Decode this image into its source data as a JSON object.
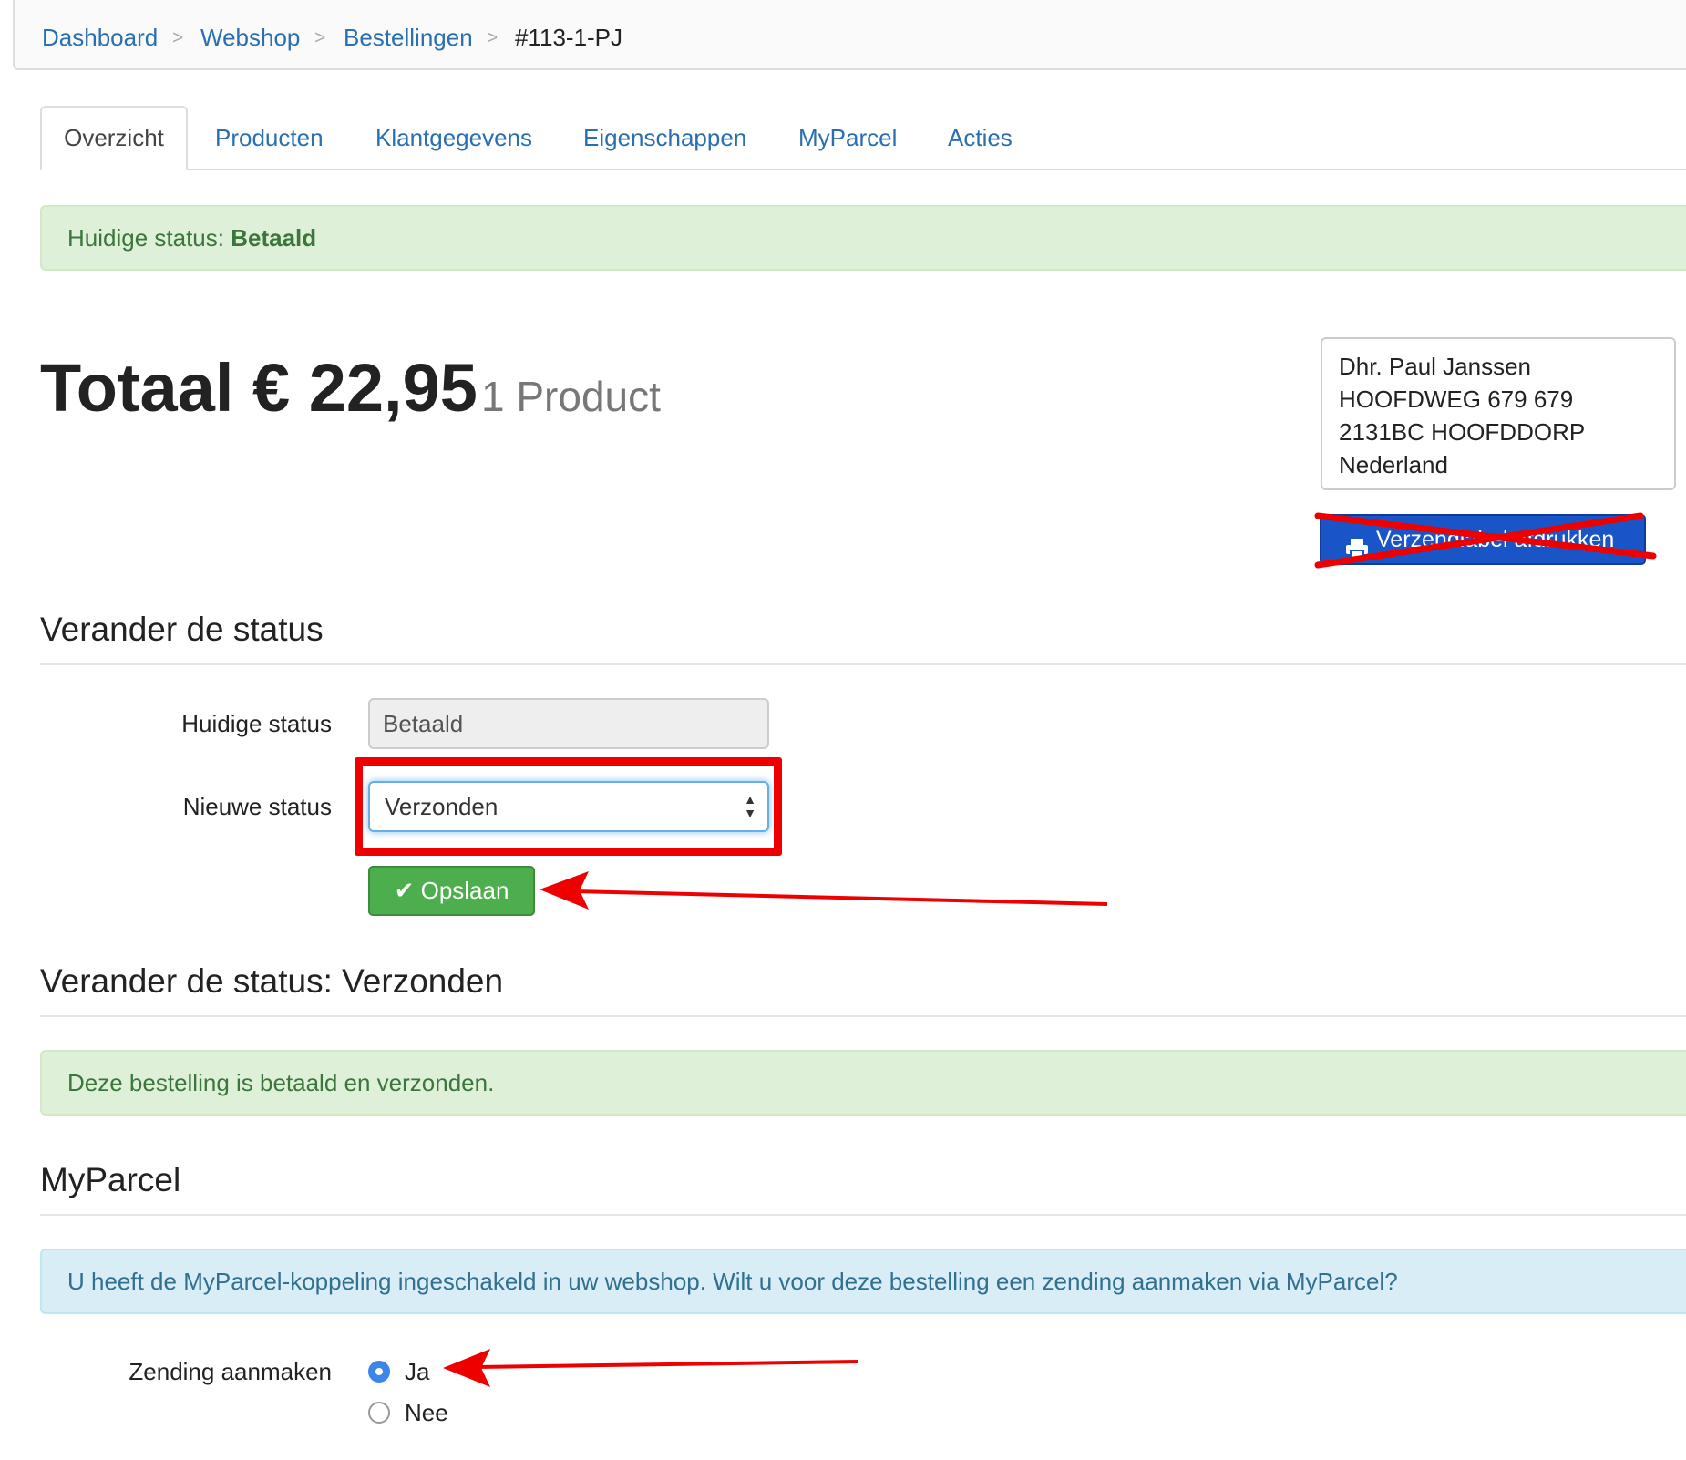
{
  "breadcrumb": {
    "items": [
      {
        "label": "Dashboard"
      },
      {
        "label": "Webshop"
      },
      {
        "label": "Bestellingen"
      }
    ],
    "current": "#113-1-PJ",
    "separator": ">"
  },
  "tabs": [
    {
      "label": "Overzicht",
      "active": true
    },
    {
      "label": "Producten"
    },
    {
      "label": "Klantgegevens"
    },
    {
      "label": "Eigenschappen"
    },
    {
      "label": "MyParcel"
    },
    {
      "label": "Acties"
    }
  ],
  "status_alert": {
    "prefix": "Huidige status:",
    "value": "Betaald"
  },
  "total": {
    "label": "Totaal € 22,95",
    "count": "1 Product"
  },
  "address": {
    "lines": [
      "Dhr. Paul Janssen",
      "HOOFDWEG 679 679",
      "2131BC HOOFDDORP",
      "Nederland"
    ]
  },
  "print_button": {
    "label": "Verzendlabel afdrukken",
    "icon": "printer-icon",
    "struck_out": true
  },
  "change_status": {
    "heading": "Verander de status",
    "current_label": "Huidige status",
    "current_value": "Betaald",
    "new_label": "Nieuwe status",
    "new_value": "Verzonden",
    "save_label": "Opslaan"
  },
  "status_result": {
    "heading": "Verander de status: Verzonden",
    "message": "Deze bestelling is betaald en verzonden."
  },
  "myparcel": {
    "heading": "MyParcel",
    "info": "U heeft de MyParcel-koppeling ingeschakeld in uw webshop. Wilt u voor deze bestelling een zending aanmaken via MyParcel?",
    "field_label": "Zending aanmaken",
    "options": [
      {
        "label": "Ja",
        "checked": true
      },
      {
        "label": "Nee",
        "checked": false
      }
    ]
  },
  "colors": {
    "link": "#2a6fb0",
    "success_bg": "#dff0d8",
    "info_bg": "#d9edf7",
    "save_green": "#4cae4c",
    "print_blue": "#1a55c8",
    "annotation_red": "#ee0000"
  }
}
